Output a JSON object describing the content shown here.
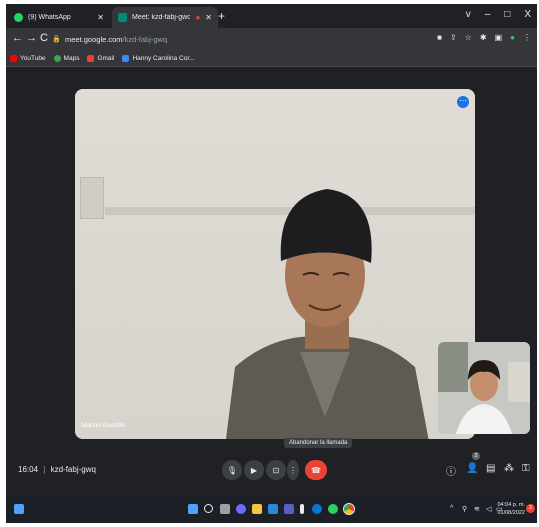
{
  "browser": {
    "tabs": [
      {
        "label": "(9) WhatsApp",
        "active": false,
        "icon": "whatsapp-icon",
        "color": "#25d366"
      },
      {
        "label": "Meet: kzd-fabj-gwq",
        "active": true,
        "icon": "meet-icon",
        "color": "#00897b"
      }
    ],
    "new_tab": "+",
    "window_controls": [
      "v",
      "–",
      "□",
      "X"
    ],
    "url_host": "meet.google.com",
    "url_path": "/kzd-fabj-gwq",
    "bookmarks": [
      {
        "label": "YouTube",
        "icon": "youtube-icon",
        "color": "#ff0000"
      },
      {
        "label": "Maps",
        "icon": "maps-icon",
        "color": "#34a853"
      },
      {
        "label": "Gmail",
        "icon": "gmail-icon",
        "color": "#ea4335"
      },
      {
        "label": "Hanny Carolina Cor...",
        "icon": "docs-icon",
        "color": "#4285f4"
      }
    ]
  },
  "meet": {
    "main_participant": "Marlon Gordillo",
    "tooltip": "Abandonar la llamada",
    "time": "16:04",
    "separator": "|",
    "meeting_code": "kzd-fabj-gwq",
    "participants_count": "2"
  },
  "taskbar": {
    "time": "04:04 p. m.",
    "date": "01/08/2022",
    "notification_count": "2"
  },
  "colors": {
    "end_call": "#ea4335",
    "accent": "#1a73e8",
    "background": "#202124"
  }
}
